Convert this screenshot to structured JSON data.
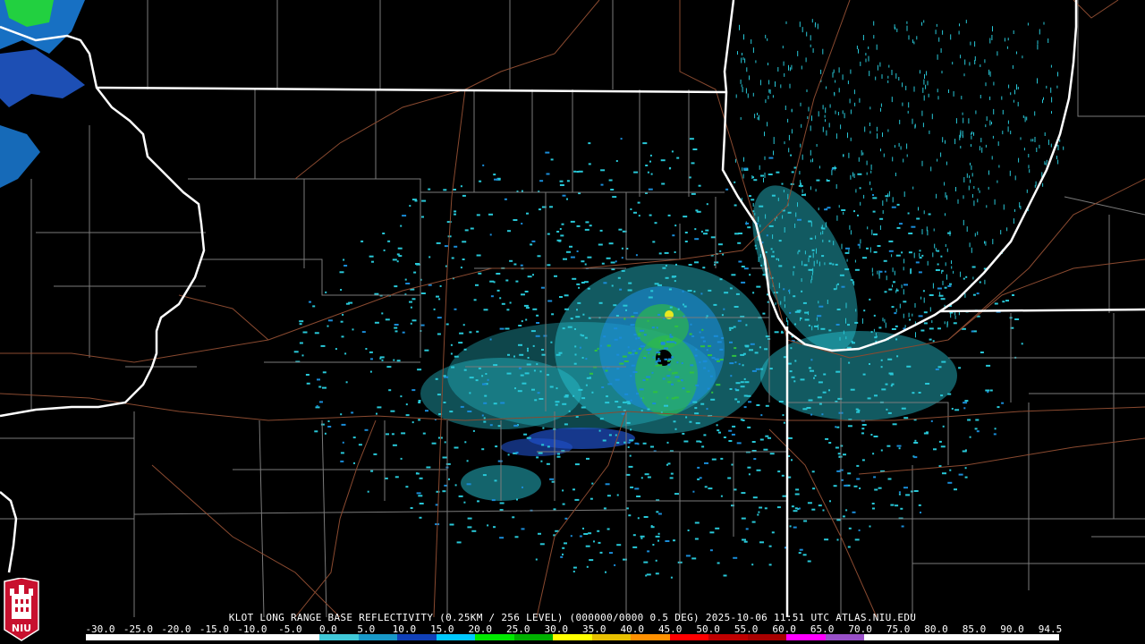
{
  "caption": "KLOT LONG RANGE BASE REFLECTIVITY (0.25KM / 256 LEVEL) (000000/0000 0.5 DEG) 2025-10-06 11:51 UTC  ATLAS.NIU.EDU",
  "logo_text": "NIU",
  "legend": {
    "ticks": [
      "-30.0",
      "-25.0",
      "-20.0",
      "-15.0",
      "-10.0",
      "-5.0",
      "0.0",
      "5.0",
      "10.0",
      "15.0",
      "20.0",
      "25.0",
      "30.0",
      "35.0",
      "40.0",
      "45.0",
      "50.0",
      "55.0",
      "60.0",
      "65.0",
      "70.0",
      "75.0",
      "80.0",
      "85.0",
      "90.0",
      "94.5"
    ],
    "colors": [
      "#ffffff",
      "#ffffff",
      "#ffffff",
      "#ffffff",
      "#ffffff",
      "#ffffff",
      "#40c8d8",
      "#1898c8",
      "#1040b8",
      "#00c8ff",
      "#00e800",
      "#00b000",
      "#ffff00",
      "#e8c000",
      "#ff9000",
      "#ff0000",
      "#c00000",
      "#a80000",
      "#ff00ff",
      "#9850c8",
      "#ffffff",
      "#ffffff",
      "#ffffff",
      "#ffffff",
      "#ffffff"
    ]
  },
  "colors": {
    "background": "#000000",
    "state_border": "#ffffff",
    "county_border": "#7a7a7a",
    "highway": "#8a4a30",
    "echo_light": "#28c8d8",
    "echo_mid": "#1a8cd8",
    "echo_blue": "#2050c8",
    "echo_green": "#30c040",
    "echo_yellow": "#e8e820"
  }
}
